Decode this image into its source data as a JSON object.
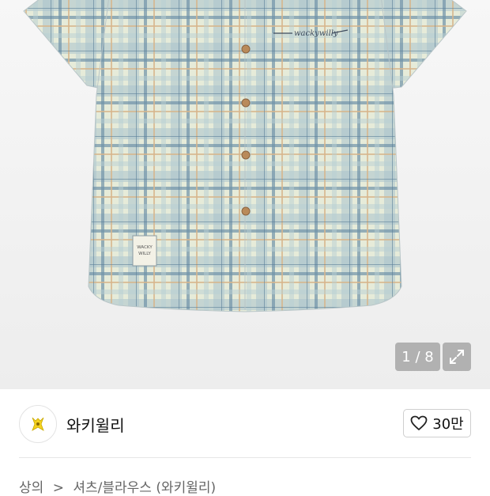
{
  "gallery": {
    "counter": "1 / 8",
    "shirt_tag_line1": "WACKY",
    "shirt_tag_line2": "WILLY",
    "chest_embroidery": "wackywilly"
  },
  "brand": {
    "name": "와키윌리",
    "like_count": "30만"
  },
  "breadcrumb": {
    "category": "상의",
    "separator": ">",
    "subcategory": "셔츠/블라우스 (와키윌리)"
  },
  "colors": {
    "background": "#ffffff",
    "shirt_base": "#e7ecd9",
    "shirt_plaid_blue": "#7ea0b4",
    "shirt_plaid_tan": "#d9b98f",
    "logo_yellow": "#f4d21f"
  }
}
